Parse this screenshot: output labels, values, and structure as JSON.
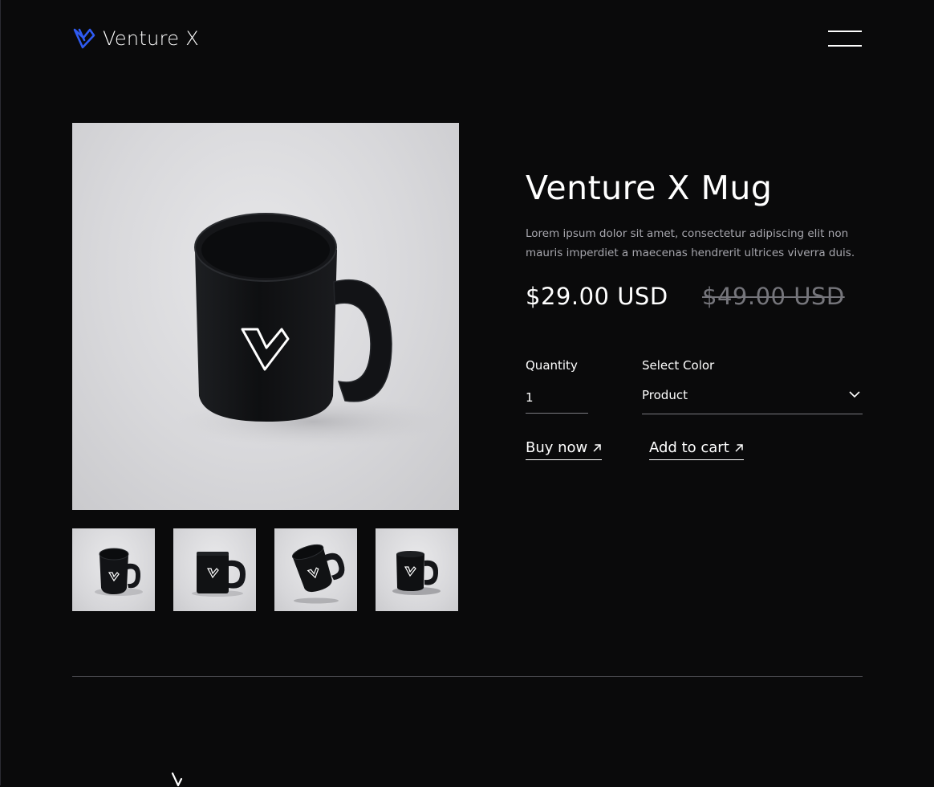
{
  "header": {
    "brand_name": "Venture X",
    "logo_icon": "venture-x-v-logo",
    "menu_icon": "hamburger-menu-icon"
  },
  "colors": {
    "background": "#0a0a0b",
    "accent_blue": "#2f5bf2",
    "text": "#ffffff",
    "muted": "#a6a6ad",
    "old_price": "#75757b"
  },
  "gallery": {
    "main_image": "black-mug-front",
    "thumbnails": [
      "black-mug-angle",
      "black-mug-side",
      "black-mug-tilted",
      "black-mug-dark"
    ]
  },
  "product": {
    "title": "Venture X Mug",
    "description": "Lorem ipsum dolor sit amet, consectetur adipiscing elit non mauris imperdiet a maecenas hendrerit ultrices viverra duis.",
    "price": "$29.00 USD",
    "old_price": "$49.00 USD"
  },
  "form": {
    "quantity_label": "Quantity",
    "quantity_value": "1",
    "color_label": "Select Color",
    "color_value": "Product"
  },
  "actions": {
    "buy_now": "Buy now",
    "add_to_cart": "Add to cart"
  }
}
